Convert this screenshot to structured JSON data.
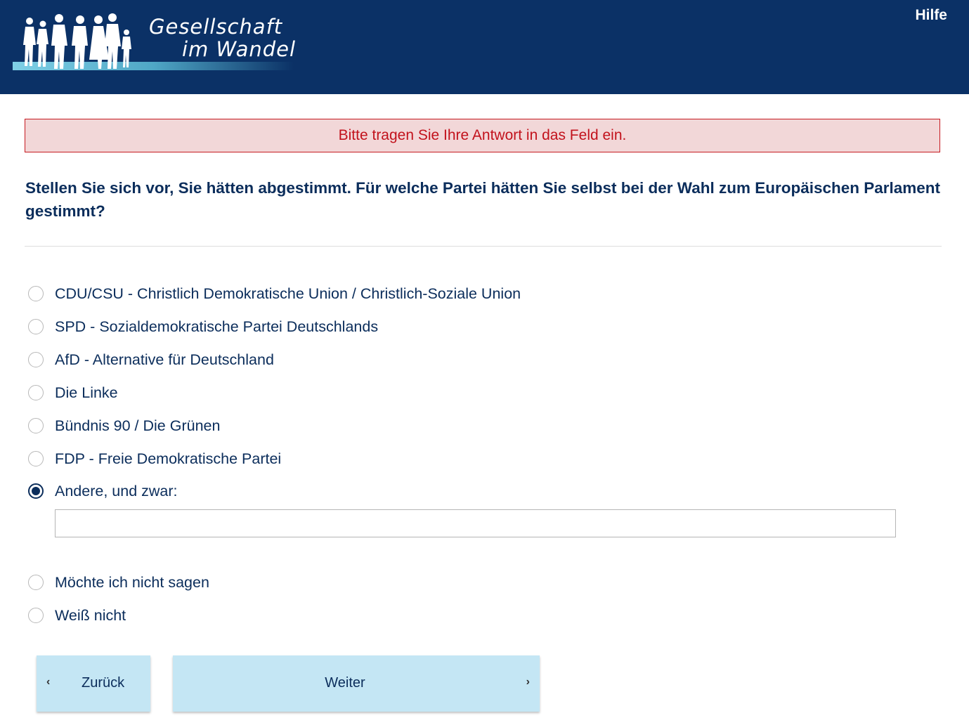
{
  "header": {
    "logo_line1": "Gesellschaft",
    "logo_line2": "im Wandel",
    "help_label": "Hilfe"
  },
  "alert": {
    "message": "Bitte tragen Sie Ihre Antwort in das Feld ein."
  },
  "question": {
    "text": "Stellen Sie sich vor, Sie hätten abgestimmt. Für welche Partei hätten Sie selbst bei der Wahl zum Europäischen Parlament gestimmt?"
  },
  "options": [
    {
      "label": "CDU/CSU - Christlich Demokratische Union / Christlich-Soziale Union",
      "checked": false
    },
    {
      "label": "SPD - Sozialdemokratische Partei Deutschlands",
      "checked": false
    },
    {
      "label": "AfD - Alternative für Deutschland",
      "checked": false
    },
    {
      "label": "Die Linke",
      "checked": false
    },
    {
      "label": "Bündnis 90 / Die Grünen",
      "checked": false
    },
    {
      "label": "FDP - Freie Demokratische Partei",
      "checked": false
    },
    {
      "label": "Andere, und zwar:",
      "checked": true
    },
    {
      "label": "Möchte ich nicht sagen",
      "checked": false
    },
    {
      "label": "Weiß nicht",
      "checked": false
    }
  ],
  "other_input": {
    "value": "",
    "placeholder": ""
  },
  "nav": {
    "back_label": "Zurück",
    "next_label": "Weiter",
    "back_icon": "chevron-left-icon",
    "next_icon": "chevron-right-icon"
  },
  "colors": {
    "header_bg": "#0b3166",
    "primary_text": "#0b2d5b",
    "alert_bg": "#f2d7d8",
    "alert_text": "#c2121c",
    "button_bg": "#c4e6f4"
  }
}
